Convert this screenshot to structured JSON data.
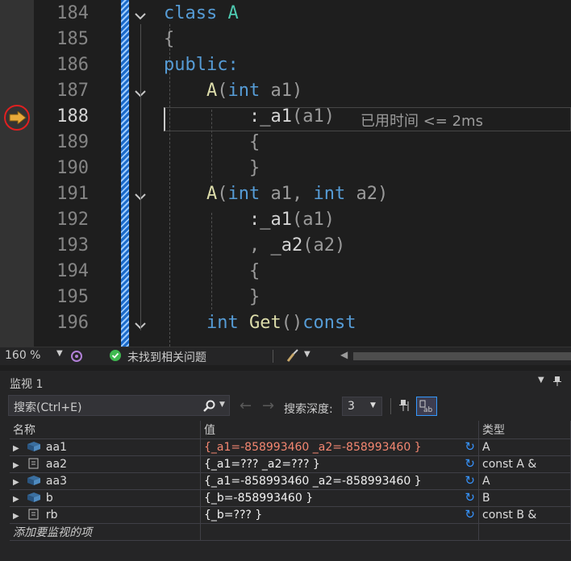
{
  "editor": {
    "lines": [
      "184",
      "185",
      "186",
      "187",
      "188",
      "189",
      "190",
      "191",
      "192",
      "193",
      "194",
      "195",
      "196"
    ],
    "current_line": "188",
    "code": {
      "l184_kw": "class",
      "l184_name": "A",
      "l185": "{",
      "l186": "public:",
      "l187_fn": "A",
      "l187_open": "(",
      "l187_kw": "int",
      "l187_param": "a1",
      "l187_close": ")",
      "l188_colon": ":",
      "l188_member": "_a1",
      "l188_open": "(",
      "l188_arg": "a1",
      "l188_close": ")",
      "l189": "{",
      "l190": "}",
      "l191_fn": "A",
      "l191_open": "(",
      "l191_kw1": "int",
      "l191_p1": "a1",
      "l191_comma": ",",
      "l191_kw2": "int",
      "l191_p2": "a2",
      "l191_close": ")",
      "l192_colon": ":",
      "l192_member": "_a1",
      "l192_open": "(",
      "l192_arg": "a1",
      "l192_close": ")",
      "l193_comma": ",",
      "l193_member": "_a2",
      "l193_open": "(",
      "l193_arg": "a2",
      "l193_close": ")",
      "l194": "{",
      "l195": "}",
      "l196_kw": "int",
      "l196_fn": "Get",
      "l196_parens": "()",
      "l196_const": "const"
    },
    "timing_hint": "已用时间 <= 2ms"
  },
  "statusbar": {
    "zoom": "160 %",
    "status_message": "未找到相关问题"
  },
  "watch": {
    "title": "监视 1",
    "search_placeholder": "搜索(Ctrl+E)",
    "depth_label": "搜索深度:",
    "depth_value": "3",
    "columns": [
      "名称",
      "值",
      "类型"
    ],
    "rows": [
      {
        "name": "aa1",
        "value": "{_a1=-858993460 _a2=-858993460 }",
        "type": "A",
        "changed": true
      },
      {
        "name": "aa2",
        "value": "{_a1=??? _a2=??? }",
        "type": "const A &",
        "changed": false
      },
      {
        "name": "aa3",
        "value": "{_a1=-858993460 _a2=-858993460 }",
        "type": "A",
        "changed": false
      },
      {
        "name": "b",
        "value": "{_b=-858993460 }",
        "type": "B",
        "changed": false
      },
      {
        "name": "rb",
        "value": "{_b=??? }",
        "type": "const B &",
        "changed": false
      }
    ],
    "add_item_placeholder": "添加要监视的项"
  }
}
